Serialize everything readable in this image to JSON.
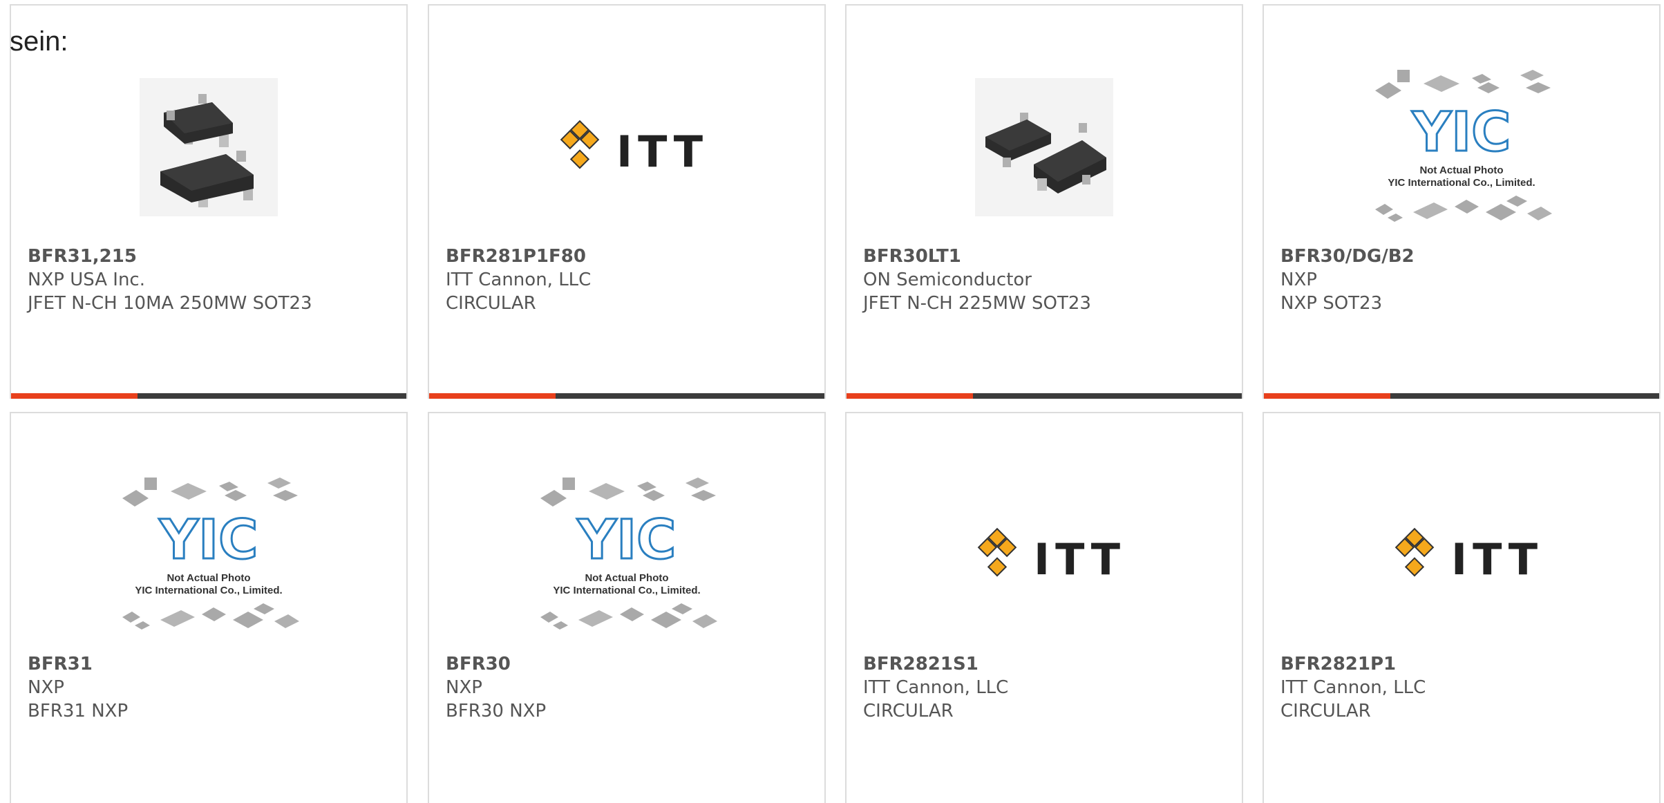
{
  "intro_text": "sein:",
  "colors": {
    "accent": "#e8401c",
    "bar": "#3c3c3c",
    "itt_orange": "#f5a81c",
    "yic_blue": "#2a7fc0"
  },
  "cards": [
    {
      "part_number": "BFR31,215",
      "manufacturer": "NXP USA Inc.",
      "description": "JFET N-CH 10MA 250MW SOT23",
      "image": "sot23-package-photo"
    },
    {
      "part_number": "BFR281P1F80",
      "manufacturer": "ITT Cannon, LLC",
      "description": "CIRCULAR",
      "image": "itt-logo"
    },
    {
      "part_number": "BFR30LT1",
      "manufacturer": "ON Semiconductor",
      "description": "JFET N-CH 225MW SOT23",
      "image": "sot23-package-photo"
    },
    {
      "part_number": "BFR30/DG/B2",
      "manufacturer": "NXP",
      "description": "NXP SOT23",
      "image": "yic-placeholder"
    },
    {
      "part_number": "BFR31",
      "manufacturer": "NXP",
      "description": "BFR31 NXP",
      "image": "yic-placeholder"
    },
    {
      "part_number": "BFR30",
      "manufacturer": "NXP",
      "description": "BFR30 NXP",
      "image": "yic-placeholder"
    },
    {
      "part_number": "BFR2821S1",
      "manufacturer": "ITT Cannon, LLC",
      "description": "CIRCULAR",
      "image": "itt-logo"
    },
    {
      "part_number": "BFR2821P1",
      "manufacturer": "ITT Cannon, LLC",
      "description": "CIRCULAR",
      "image": "itt-logo"
    }
  ],
  "logos": {
    "itt_text": "ITT",
    "yic_text": "YIC",
    "yic_caption_line1": "Not Actual Photo",
    "yic_caption_line2": "YIC International Co., Limited."
  }
}
